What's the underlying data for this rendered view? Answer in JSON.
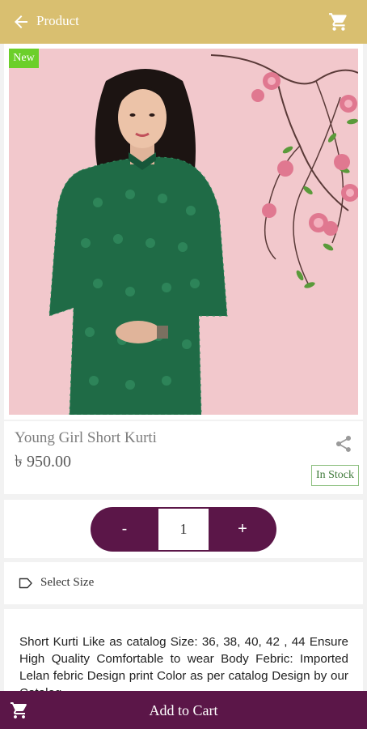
{
  "appbar": {
    "title": "Product",
    "icons": [
      "back-arrow-icon",
      "cart-icon"
    ]
  },
  "product": {
    "badge": "New",
    "name": "Young Girl Short Kurti",
    "price": "৳ 950.00",
    "stock": "In Stock"
  },
  "quantity": {
    "minus": "-",
    "value": "1",
    "plus": "+"
  },
  "size": {
    "label": "Select Size"
  },
  "description": "Short Kurti Like as catalog Size: 36, 38, 40, 42 , 44 Ensure High Quality Comfortable to wear Body Febric: Imported Lelan febric Design print Color as per catalog Design by our Catalog",
  "bottom": {
    "add_label": "Add to Cart"
  },
  "colors": {
    "appbar": "#d9bf70",
    "accent": "#5b1648",
    "badge": "#6ccf2a",
    "stock": "#3f7a3a"
  }
}
